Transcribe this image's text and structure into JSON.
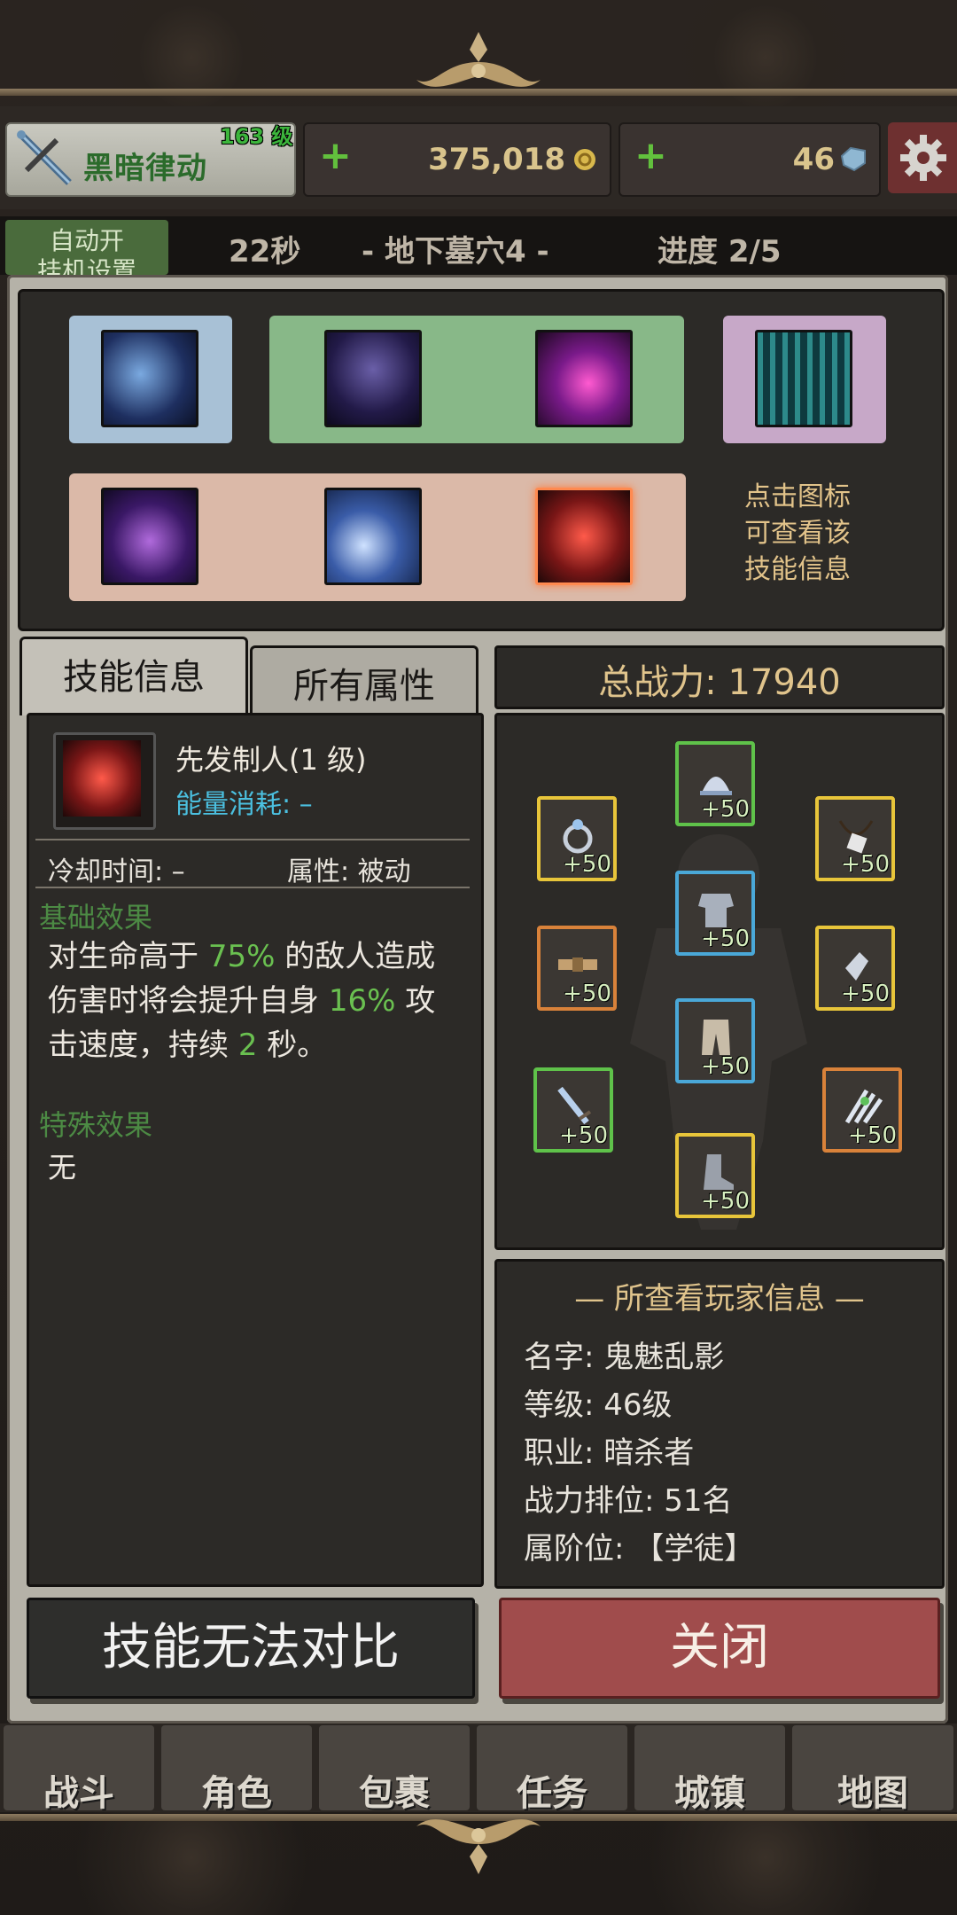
{
  "header": {
    "char_name": "黑暗律动",
    "level_badge": "163 级",
    "gold": "375,018",
    "gems": "46",
    "auto_btn": [
      "自动开",
      "挂机设置"
    ],
    "timer": "22秒",
    "location": "-  地下墓穴4  -",
    "progress": "进度 2/5"
  },
  "skills": {
    "hint_lines": [
      "点击图标",
      "可查看该",
      "技能信息"
    ]
  },
  "tabs": {
    "skill_info": "技能信息",
    "all_attributes": "所有属性"
  },
  "skill_info": {
    "name": "先发制人(1 级)",
    "energy": "能量消耗: –",
    "cooldown": "冷却时间: –",
    "attribute": "属性: 被动",
    "base_effect_title": "基础效果",
    "base_effect": {
      "p1": "对生命高于 ",
      "v1": "75%",
      "p2": " 的敌人造成伤害时将会提升自身 ",
      "v2": "16%",
      "p3": " 攻击速度，持续 ",
      "v3": "2",
      "p4": " 秒。"
    },
    "special_effect_title": "特殊效果",
    "special_effect": "无"
  },
  "power": {
    "label": "总战力:  17940"
  },
  "equipment": [
    {
      "slot": "helmet",
      "bonus": "+50",
      "rarity_color": "#5fc24a"
    },
    {
      "slot": "ring",
      "bonus": "+50",
      "rarity_color": "#e8c53a"
    },
    {
      "slot": "necklace",
      "bonus": "+50",
      "rarity_color": "#e8c53a"
    },
    {
      "slot": "armor",
      "bonus": "+50",
      "rarity_color": "#4aa8d8"
    },
    {
      "slot": "belt",
      "bonus": "+50",
      "rarity_color": "#d9823a"
    },
    {
      "slot": "gloves",
      "bonus": "+50",
      "rarity_color": "#e8c53a"
    },
    {
      "slot": "pants",
      "bonus": "+50",
      "rarity_color": "#4aa8d8"
    },
    {
      "slot": "weapon",
      "bonus": "+50",
      "rarity_color": "#5fc24a"
    },
    {
      "slot": "offhand",
      "bonus": "+50",
      "rarity_color": "#d9823a"
    },
    {
      "slot": "boots",
      "bonus": "+50",
      "rarity_color": "#e8c53a"
    }
  ],
  "player": {
    "title": "— 所查看玩家信息 —",
    "name": "名字:  鬼魅乱影",
    "level": "等级:  46级",
    "class": "职业:  暗杀者",
    "rank": "战力排位:  51名",
    "tier": "属阶位:  【学徒】"
  },
  "buttons": {
    "compare": "技能无法对比",
    "close": "关闭"
  },
  "nav": [
    "战斗",
    "角色",
    "包裹",
    "任务",
    "城镇",
    "地图"
  ]
}
